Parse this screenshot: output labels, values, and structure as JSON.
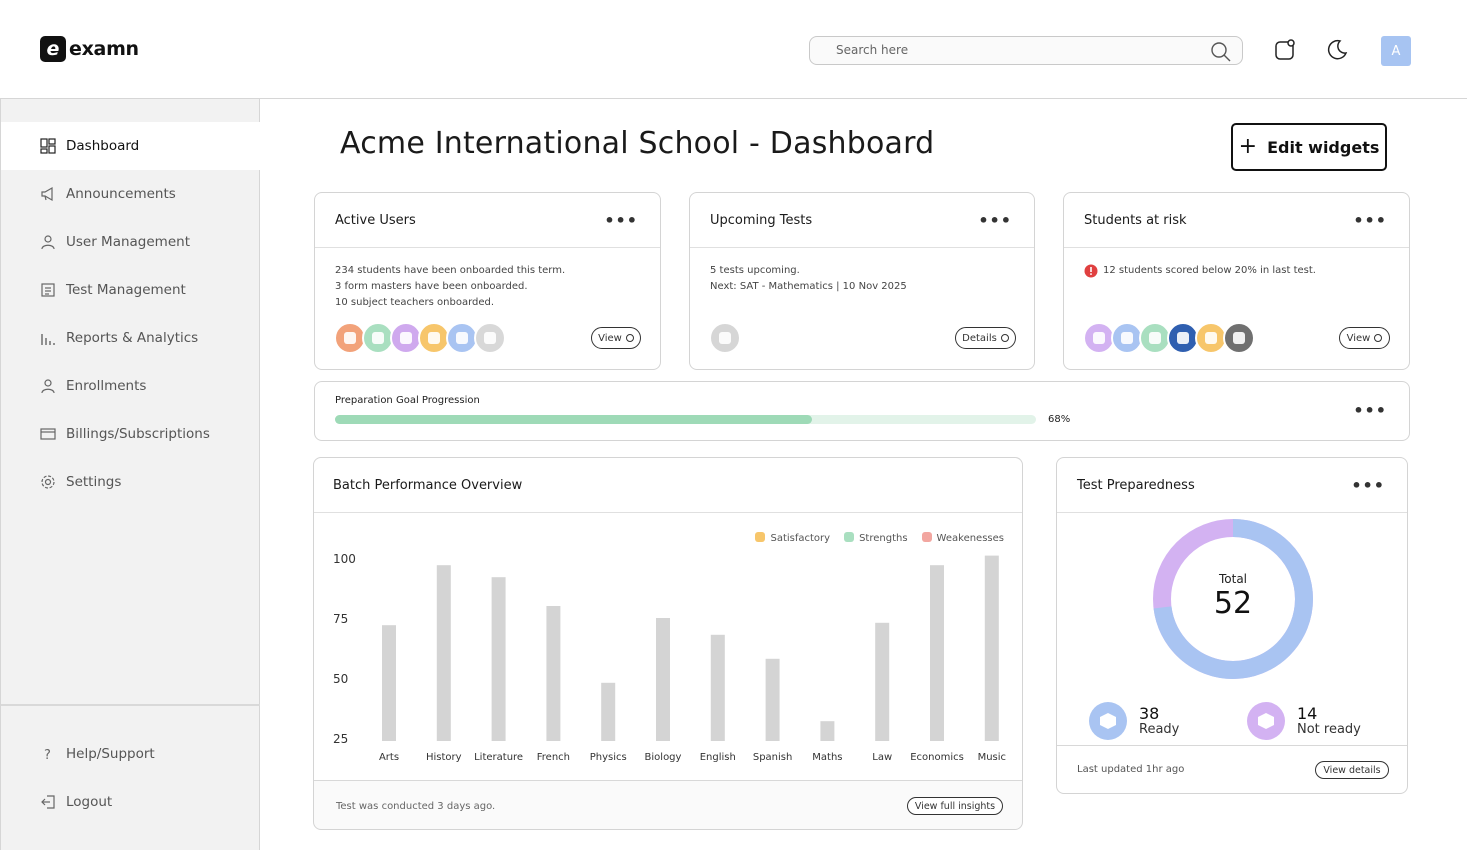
{
  "brand": {
    "name": "examn",
    "mark": "e"
  },
  "search": {
    "placeholder": "Search here"
  },
  "user": {
    "initial": "A"
  },
  "sidebar": {
    "items": [
      {
        "label": "Dashboard",
        "icon": "dashboard-icon",
        "active": true
      },
      {
        "label": "Announcements",
        "icon": "megaphone-icon"
      },
      {
        "label": "User Management",
        "icon": "user-icon"
      },
      {
        "label": "Test Management",
        "icon": "test-icon"
      },
      {
        "label": "Reports & Analytics",
        "icon": "bar-chart-icon"
      },
      {
        "label": "Enrollments",
        "icon": "user-icon"
      },
      {
        "label": "Billings/Subscriptions",
        "icon": "card-icon"
      },
      {
        "label": "Settings",
        "icon": "gear-icon"
      }
    ],
    "bottom": [
      {
        "label": "Help/Support",
        "icon": "question-icon"
      },
      {
        "label": "Logout",
        "icon": "logout-icon"
      }
    ]
  },
  "page": {
    "title": "Acme International School - Dashboard",
    "edit_widgets": "Edit widgets"
  },
  "active_users": {
    "title": "Active Users",
    "lines": [
      "234 students have been onboarded this term.",
      "3 form masters have been onboarded.",
      "10  subject teachers onboarded."
    ],
    "button": "View",
    "avatar_colors": [
      "#f2a27a",
      "#a9dfc0",
      "#cfa9ee",
      "#f7c66b",
      "#a9c4f2",
      "#d8d8d8"
    ]
  },
  "upcoming_tests": {
    "title": "Upcoming Tests",
    "lines": [
      "5 tests upcoming.",
      "Next: SAT - Mathematics | 10 Nov  2025"
    ],
    "button": "Details",
    "avatar_colors": [
      "#d6d6d6"
    ]
  },
  "students_at_risk": {
    "title": "Students at risk",
    "alert": "12 students scored below 20% in last test.",
    "button": "View",
    "avatar_colors": [
      "#d3b2f2",
      "#a9c4f2",
      "#a9dfc0",
      "#2f5fb0",
      "#f7c66b",
      "#707070"
    ]
  },
  "preparation": {
    "label": "Preparation Goal Progression",
    "value_text": "68%",
    "value": 0.68
  },
  "batch": {
    "title": "Batch Performance Overview",
    "footer_note": "Test was conducted 3 days ago.",
    "button": "View full insights"
  },
  "chart_data": {
    "type": "bar",
    "categories": [
      "Arts",
      "History",
      "Literature",
      "French",
      "Physics",
      "Biology",
      "English",
      "Spanish",
      "Maths",
      "Law",
      "Economics",
      "Music"
    ],
    "values": [
      72,
      97,
      92,
      80,
      48,
      75,
      68,
      58,
      32,
      73,
      97,
      101
    ],
    "ylim": [
      25,
      100
    ],
    "yticks": [
      "100",
      "75",
      "50",
      "25"
    ],
    "legend": [
      {
        "label": "Satisfactory",
        "color": "#f7c66b"
      },
      {
        "label": "Strengths",
        "color": "#a9dfc0"
      },
      {
        "label": "Weakenesses",
        "color": "#f2a6a0"
      }
    ],
    "bar_color": "#d4d4d4",
    "legend_placement": "top-right",
    "grid": false
  },
  "preparedness": {
    "title": "Test Preparedness",
    "total_label": "Total",
    "total": "52",
    "ready_num": "38",
    "ready_label": "Ready",
    "ready_color": "#a9c4f2",
    "not_ready_num": "14",
    "not_ready_label": "Not ready",
    "not_ready_color": "#d3b2f2",
    "updated": "Last updated 1hr ago",
    "button": "View details"
  }
}
